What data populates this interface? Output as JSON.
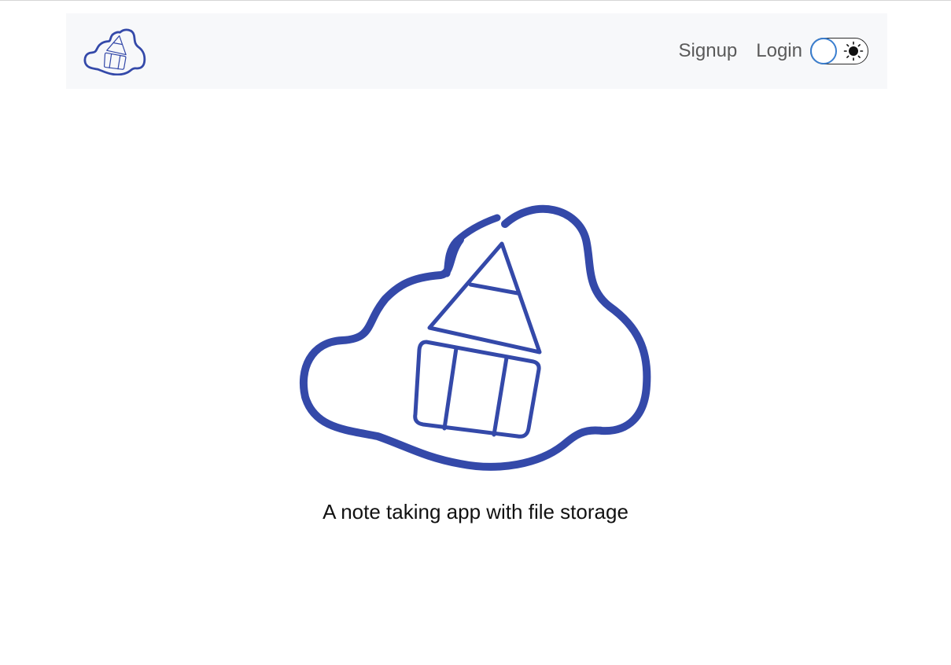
{
  "navbar": {
    "brand_icon": "cloud-pencil-logo",
    "links": {
      "signup": "Signup",
      "login": "Login"
    },
    "theme_toggle": {
      "icon": "sun-icon",
      "state": "light"
    }
  },
  "hero": {
    "logo_icon": "cloud-pencil-logo",
    "tagline": "A note taking app with file storage"
  },
  "colors": {
    "brand": "#3449a9",
    "navbar_bg": "#f7f8fa",
    "link": "#5a5a5a",
    "toggle_knob_border": "#3b7fd0"
  }
}
